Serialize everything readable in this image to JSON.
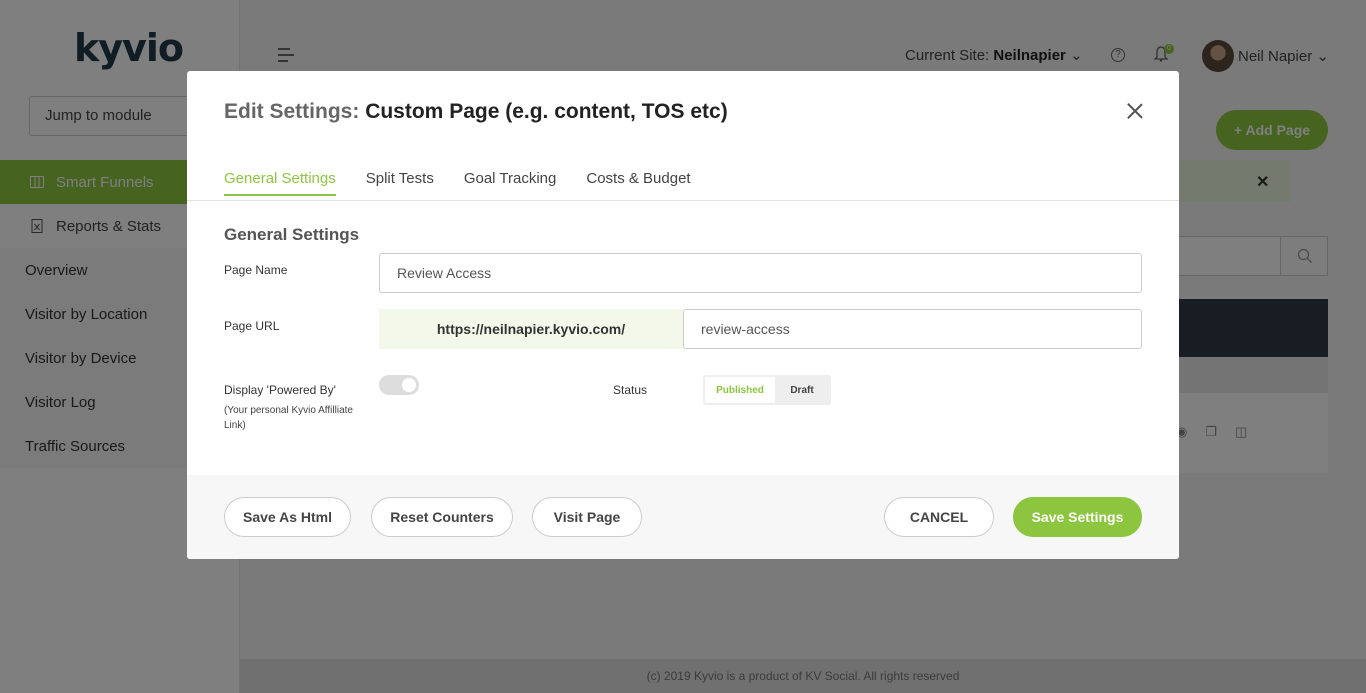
{
  "sidebar": {
    "logo": "kyvio",
    "jump_label": "Jump to module",
    "active_item": "Smart Funnels",
    "reports_item": "Reports & Stats",
    "sub_items": [
      "Overview",
      "Visitor by Location",
      "Visitor by Device",
      "Visitor Log",
      "Traffic Sources"
    ]
  },
  "header": {
    "site_label": "Current Site:",
    "site_value": "Neilnapier",
    "notification_count": "0",
    "user_name": "Neil Napier"
  },
  "background": {
    "add_page": "+ Add Page",
    "footer": "(c) 2019 Kyvio is a product of KV Social. All rights reserved"
  },
  "modal": {
    "title_prefix": "Edit Settings:",
    "title_main": "Custom Page (e.g. content, TOS etc)",
    "tabs": [
      "General Settings",
      "Split Tests",
      "Goal Tracking",
      "Costs & Budget"
    ],
    "section_title": "General Settings",
    "page_name_label": "Page Name",
    "page_name_value": "Review Access",
    "page_url_label": "Page URL",
    "url_prefix": "https://neilnapier.kyvio.com/",
    "url_slug": "review-access",
    "powered_by_label": "Display 'Powered By'",
    "powered_by_note": "(Your personal Kyvio Affilliate Link)",
    "status_label": "Status",
    "status_published": "Published",
    "status_draft": "Draft",
    "buttons": {
      "save_html": "Save As Html",
      "reset_counters": "Reset Counters",
      "visit_page": "Visit Page",
      "cancel": "CANCEL",
      "save_settings": "Save Settings"
    }
  },
  "colors": {
    "accent": "#8cc63f",
    "dark": "#233a4a"
  }
}
